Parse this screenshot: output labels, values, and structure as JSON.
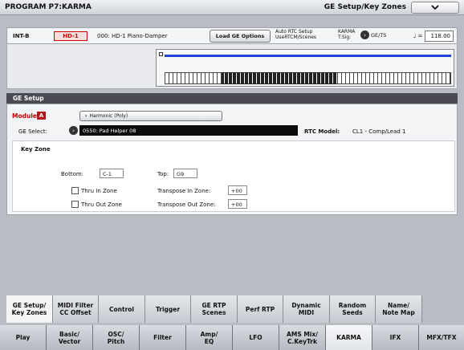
{
  "titlebar": {
    "program": "PROGRAM P7:KARMA",
    "page": "GE Setup/Key Zones",
    "menu_icon": "chevron-down-icon"
  },
  "progbar": {
    "bank": "INT-B",
    "badge": "HD-1",
    "program_name": "000: HD-1 Piano-Damper",
    "load_ge_label": "Load GE Options",
    "auto_rtc_line1": "Auto RTC Setup",
    "auto_rtc_line2": "UseRTCM/Scenes",
    "karma_line1": "KARMA",
    "karma_line2": "T.Sig:",
    "gets_label": "GE/TS",
    "tempo_symbol": "♩ =",
    "tempo": "118.00"
  },
  "ge_setup": {
    "header": "GE Setup",
    "module_label": "Module",
    "module_letter": "A",
    "harmonic_label": "Harmonic (Poly)",
    "ge_select_label": "GE Select:",
    "ge_select_value": "0550: Pad Helper 08",
    "rtc_model_label": "RTC Model:",
    "rtc_model_value": "CL1 - Comp/Lead 1"
  },
  "key_zone": {
    "title": "Key Zone",
    "bottom_label": "Bottom:",
    "bottom_value": "C-1",
    "top_label": "Top:",
    "top_value": "G9",
    "thru_in_label": "Thru In Zone",
    "thru_out_label": "Thru Out Zone",
    "transpose_in_label": "Transpose In Zone:",
    "transpose_in_value": "+00",
    "transpose_out_label": "Transpose Out Zone:",
    "transpose_out_value": "+00"
  },
  "tabs_upper": [
    {
      "l1": "GE Setup/",
      "l2": "Key Zones"
    },
    {
      "l1": "MIDI Filter",
      "l2": "CC Offset"
    },
    {
      "l1": "Control",
      "l2": ""
    },
    {
      "l1": "Trigger",
      "l2": ""
    },
    {
      "l1": "GE RTP",
      "l2": "Scenes"
    },
    {
      "l1": "Perf RTP",
      "l2": ""
    },
    {
      "l1": "Dynamic",
      "l2": "MIDI"
    },
    {
      "l1": "Random",
      "l2": "Seeds"
    },
    {
      "l1": "Name/",
      "l2": "Note Map"
    }
  ],
  "tabs_lower": [
    {
      "l1": "Play",
      "l2": ""
    },
    {
      "l1": "Basic/",
      "l2": "Vector"
    },
    {
      "l1": "OSC/",
      "l2": "Pitch"
    },
    {
      "l1": "Filter",
      "l2": ""
    },
    {
      "l1": "Amp/",
      "l2": "EQ"
    },
    {
      "l1": "LFO",
      "l2": ""
    },
    {
      "l1": "AMS Mix/",
      "l2": "C.KeyTrk"
    },
    {
      "l1": "KARMA",
      "l2": ""
    },
    {
      "l1": "IFX",
      "l2": ""
    },
    {
      "l1": "MFX/TFX",
      "l2": ""
    }
  ]
}
